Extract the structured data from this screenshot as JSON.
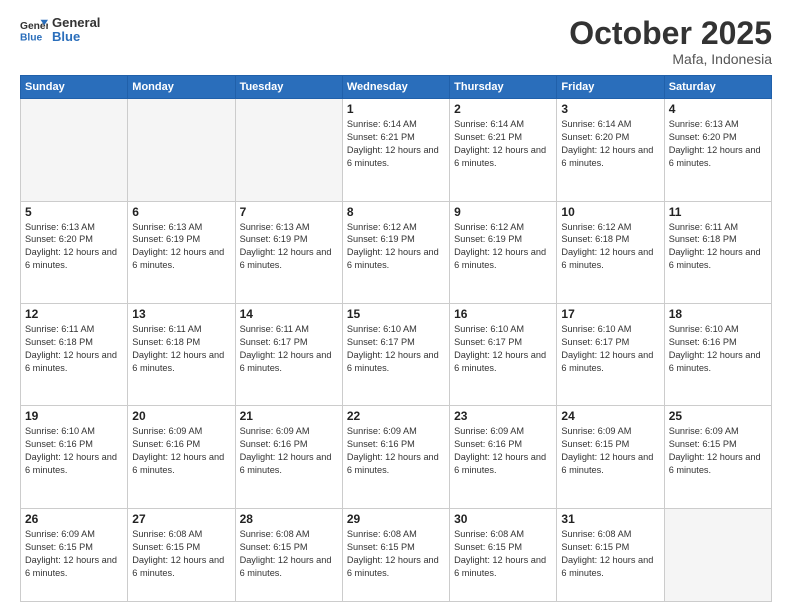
{
  "logo": {
    "general": "General",
    "blue": "Blue"
  },
  "title": "October 2025",
  "location": "Mafa, Indonesia",
  "weekdays": [
    "Sunday",
    "Monday",
    "Tuesday",
    "Wednesday",
    "Thursday",
    "Friday",
    "Saturday"
  ],
  "rows": [
    [
      {
        "day": "",
        "empty": true
      },
      {
        "day": "",
        "empty": true
      },
      {
        "day": "",
        "empty": true
      },
      {
        "day": "1",
        "sunrise": "6:14 AM",
        "sunset": "6:21 PM",
        "daylight": "12 hours and 6 minutes."
      },
      {
        "day": "2",
        "sunrise": "6:14 AM",
        "sunset": "6:21 PM",
        "daylight": "12 hours and 6 minutes."
      },
      {
        "day": "3",
        "sunrise": "6:14 AM",
        "sunset": "6:20 PM",
        "daylight": "12 hours and 6 minutes."
      },
      {
        "day": "4",
        "sunrise": "6:13 AM",
        "sunset": "6:20 PM",
        "daylight": "12 hours and 6 minutes."
      }
    ],
    [
      {
        "day": "5",
        "sunrise": "6:13 AM",
        "sunset": "6:20 PM",
        "daylight": "12 hours and 6 minutes."
      },
      {
        "day": "6",
        "sunrise": "6:13 AM",
        "sunset": "6:19 PM",
        "daylight": "12 hours and 6 minutes."
      },
      {
        "day": "7",
        "sunrise": "6:13 AM",
        "sunset": "6:19 PM",
        "daylight": "12 hours and 6 minutes."
      },
      {
        "day": "8",
        "sunrise": "6:12 AM",
        "sunset": "6:19 PM",
        "daylight": "12 hours and 6 minutes."
      },
      {
        "day": "9",
        "sunrise": "6:12 AM",
        "sunset": "6:19 PM",
        "daylight": "12 hours and 6 minutes."
      },
      {
        "day": "10",
        "sunrise": "6:12 AM",
        "sunset": "6:18 PM",
        "daylight": "12 hours and 6 minutes."
      },
      {
        "day": "11",
        "sunrise": "6:11 AM",
        "sunset": "6:18 PM",
        "daylight": "12 hours and 6 minutes."
      }
    ],
    [
      {
        "day": "12",
        "sunrise": "6:11 AM",
        "sunset": "6:18 PM",
        "daylight": "12 hours and 6 minutes."
      },
      {
        "day": "13",
        "sunrise": "6:11 AM",
        "sunset": "6:18 PM",
        "daylight": "12 hours and 6 minutes."
      },
      {
        "day": "14",
        "sunrise": "6:11 AM",
        "sunset": "6:17 PM",
        "daylight": "12 hours and 6 minutes."
      },
      {
        "day": "15",
        "sunrise": "6:10 AM",
        "sunset": "6:17 PM",
        "daylight": "12 hours and 6 minutes."
      },
      {
        "day": "16",
        "sunrise": "6:10 AM",
        "sunset": "6:17 PM",
        "daylight": "12 hours and 6 minutes."
      },
      {
        "day": "17",
        "sunrise": "6:10 AM",
        "sunset": "6:17 PM",
        "daylight": "12 hours and 6 minutes."
      },
      {
        "day": "18",
        "sunrise": "6:10 AM",
        "sunset": "6:16 PM",
        "daylight": "12 hours and 6 minutes."
      }
    ],
    [
      {
        "day": "19",
        "sunrise": "6:10 AM",
        "sunset": "6:16 PM",
        "daylight": "12 hours and 6 minutes."
      },
      {
        "day": "20",
        "sunrise": "6:09 AM",
        "sunset": "6:16 PM",
        "daylight": "12 hours and 6 minutes."
      },
      {
        "day": "21",
        "sunrise": "6:09 AM",
        "sunset": "6:16 PM",
        "daylight": "12 hours and 6 minutes."
      },
      {
        "day": "22",
        "sunrise": "6:09 AM",
        "sunset": "6:16 PM",
        "daylight": "12 hours and 6 minutes."
      },
      {
        "day": "23",
        "sunrise": "6:09 AM",
        "sunset": "6:16 PM",
        "daylight": "12 hours and 6 minutes."
      },
      {
        "day": "24",
        "sunrise": "6:09 AM",
        "sunset": "6:15 PM",
        "daylight": "12 hours and 6 minutes."
      },
      {
        "day": "25",
        "sunrise": "6:09 AM",
        "sunset": "6:15 PM",
        "daylight": "12 hours and 6 minutes."
      }
    ],
    [
      {
        "day": "26",
        "sunrise": "6:09 AM",
        "sunset": "6:15 PM",
        "daylight": "12 hours and 6 minutes."
      },
      {
        "day": "27",
        "sunrise": "6:08 AM",
        "sunset": "6:15 PM",
        "daylight": "12 hours and 6 minutes."
      },
      {
        "day": "28",
        "sunrise": "6:08 AM",
        "sunset": "6:15 PM",
        "daylight": "12 hours and 6 minutes."
      },
      {
        "day": "29",
        "sunrise": "6:08 AM",
        "sunset": "6:15 PM",
        "daylight": "12 hours and 6 minutes."
      },
      {
        "day": "30",
        "sunrise": "6:08 AM",
        "sunset": "6:15 PM",
        "daylight": "12 hours and 6 minutes."
      },
      {
        "day": "31",
        "sunrise": "6:08 AM",
        "sunset": "6:15 PM",
        "daylight": "12 hours and 6 minutes."
      },
      {
        "day": "",
        "empty": true
      }
    ]
  ]
}
